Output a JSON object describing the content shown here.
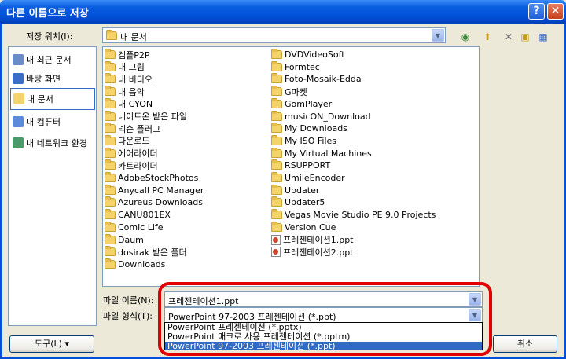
{
  "window": {
    "title": "다른 이름으로 저장",
    "help_label": "?",
    "close_label": "✕"
  },
  "location": {
    "label": "저장 위치(I):",
    "value": "내 문서"
  },
  "toolbar_icons": [
    "back-icon",
    "up-folder-icon",
    "delete-icon",
    "new-folder-icon",
    "views-icon"
  ],
  "places": [
    {
      "label": "내 최근 문서",
      "icon": "recent-documents-icon",
      "color": "#6A8CC8"
    },
    {
      "label": "바탕 화면",
      "icon": "desktop-icon",
      "color": "#3A6EC8"
    },
    {
      "label": "내 문서",
      "icon": "my-documents-icon",
      "color": "#F4D46A"
    },
    {
      "label": "내 컴퓨터",
      "icon": "my-computer-icon",
      "color": "#5A8AD8"
    },
    {
      "label": "내 네트워크 환경",
      "icon": "network-icon",
      "color": "#4A9A6A"
    }
  ],
  "files_col1": [
    {
      "name": "겜플P2P",
      "type": "folder"
    },
    {
      "name": "내 그림",
      "type": "folder"
    },
    {
      "name": "내 비디오",
      "type": "folder"
    },
    {
      "name": "내 음악",
      "type": "folder"
    },
    {
      "name": "내 CYON",
      "type": "folder"
    },
    {
      "name": "네이트온 받은 파일",
      "type": "folder"
    },
    {
      "name": "넥슨 플러그",
      "type": "folder"
    },
    {
      "name": "다운로드",
      "type": "folder"
    },
    {
      "name": "에어라이더",
      "type": "folder"
    },
    {
      "name": "카트라이더",
      "type": "folder"
    },
    {
      "name": "AdobeStockPhotos",
      "type": "folder"
    },
    {
      "name": "Anycall PC Manager",
      "type": "folder"
    },
    {
      "name": "Azureus Downloads",
      "type": "folder"
    },
    {
      "name": "CANU801EX",
      "type": "folder"
    },
    {
      "name": "Comic Life",
      "type": "folder"
    },
    {
      "name": "Daum",
      "type": "folder"
    },
    {
      "name": "dosirak 받은 폴더",
      "type": "folder"
    },
    {
      "name": "Downloads",
      "type": "folder"
    }
  ],
  "files_col2": [
    {
      "name": "DVDVideoSoft",
      "type": "folder"
    },
    {
      "name": "Formtec",
      "type": "folder"
    },
    {
      "name": "Foto-Mosaik-Edda",
      "type": "folder"
    },
    {
      "name": "G마켓",
      "type": "folder"
    },
    {
      "name": "GomPlayer",
      "type": "folder"
    },
    {
      "name": "musicON_Download",
      "type": "folder"
    },
    {
      "name": "My Downloads",
      "type": "folder"
    },
    {
      "name": "My ISO Files",
      "type": "folder"
    },
    {
      "name": "My Virtual Machines",
      "type": "folder"
    },
    {
      "name": "RSUPPORT",
      "type": "folder"
    },
    {
      "name": "UmileEncoder",
      "type": "folder"
    },
    {
      "name": "Updater",
      "type": "folder"
    },
    {
      "name": "Updater5",
      "type": "folder"
    },
    {
      "name": "Vegas Movie Studio PE 9.0 Projects",
      "type": "folder"
    },
    {
      "name": "Version Cue",
      "type": "folder"
    },
    {
      "name": "프레젠테이션1.ppt",
      "type": "ppt"
    },
    {
      "name": "프레젠테이션2.ppt",
      "type": "ppt"
    }
  ],
  "filename": {
    "label": "파일 이름(N):",
    "value": "프레젠테이션1.ppt"
  },
  "filetype": {
    "label": "파일 형식(T):",
    "value": "PowerPoint 97-2003 프레젠테이션 (*.ppt)",
    "options": [
      "PowerPoint 프레젠테이션 (*.pptx)",
      "PowerPoint 매크로 사용 프레젠테이션 (*.pptm)",
      "PowerPoint 97-2003 프레젠테이션 (*.ppt)"
    ],
    "selected_index": 2
  },
  "buttons": {
    "tools": "도구(L)",
    "cancel": "취소"
  }
}
